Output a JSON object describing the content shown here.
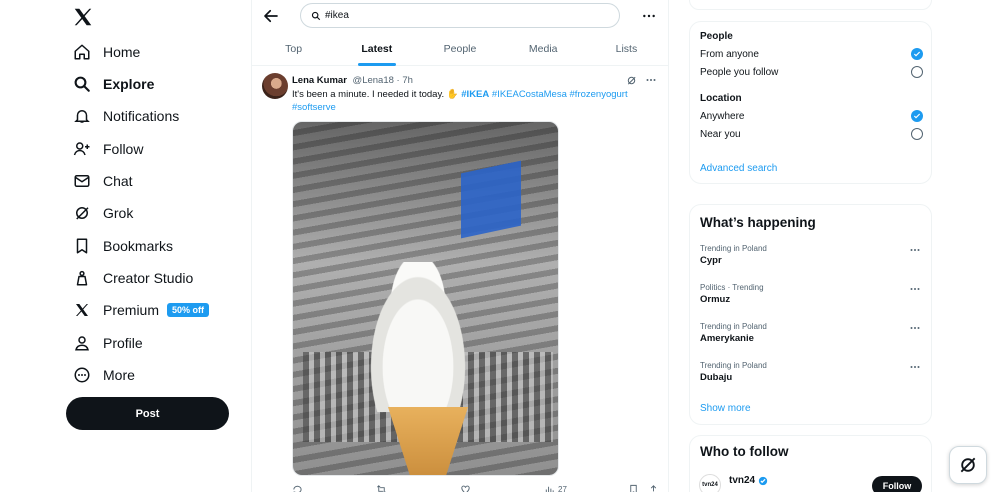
{
  "nav": {
    "items": [
      {
        "label": "Home",
        "icon": "home-icon"
      },
      {
        "label": "Explore",
        "icon": "search-icon"
      },
      {
        "label": "Notifications",
        "icon": "bell-icon"
      },
      {
        "label": "Follow",
        "icon": "add-user-icon"
      },
      {
        "label": "Chat",
        "icon": "mail-icon"
      },
      {
        "label": "Grok",
        "icon": "grok-icon"
      },
      {
        "label": "Bookmarks",
        "icon": "bookmark-icon"
      },
      {
        "label": "Creator Studio",
        "icon": "creator-icon"
      },
      {
        "label": "Premium",
        "icon": "x-logo-icon"
      },
      {
        "label": "Profile",
        "icon": "person-icon"
      },
      {
        "label": "More",
        "icon": "more-circle-icon"
      }
    ],
    "premium_badge": "50% off",
    "post_label": "Post"
  },
  "search": {
    "value": "#ikea"
  },
  "tabs": [
    "Top",
    "Latest",
    "People",
    "Media",
    "Lists"
  ],
  "tweet": {
    "name": "Lena Kumar",
    "handle": "@Lena18",
    "time": "7h",
    "text_plain": "It's been a minute. I needed it today. ✋",
    "hashtag_1": "#IKEA",
    "hashtag_2": "#IKEACostaMesa",
    "hashtag_3": "#frozenyogurt",
    "hashtag_4": "#softserve",
    "views": "27"
  },
  "filters": {
    "people_title": "People",
    "from_anyone": "From anyone",
    "people_you_follow": "People you follow",
    "location_title": "Location",
    "anywhere": "Anywhere",
    "near_you": "Near you",
    "advanced": "Advanced search"
  },
  "happening": {
    "title": "What’s happening",
    "trends": [
      {
        "context": "Trending in Poland",
        "name": "Cypr"
      },
      {
        "context": "Politics · Trending",
        "name": "Ormuz"
      },
      {
        "context": "Trending in Poland",
        "name": "Amerykanie"
      },
      {
        "context": "Trending in Poland",
        "name": "Dubaju"
      }
    ],
    "show_more": "Show more"
  },
  "who_to_follow": {
    "title": "Who to follow",
    "account_name": "tvn24",
    "follow_label": "Follow"
  },
  "colors": {
    "accent": "#1d9bf0",
    "text": "#0f1419",
    "muted": "#536471"
  }
}
